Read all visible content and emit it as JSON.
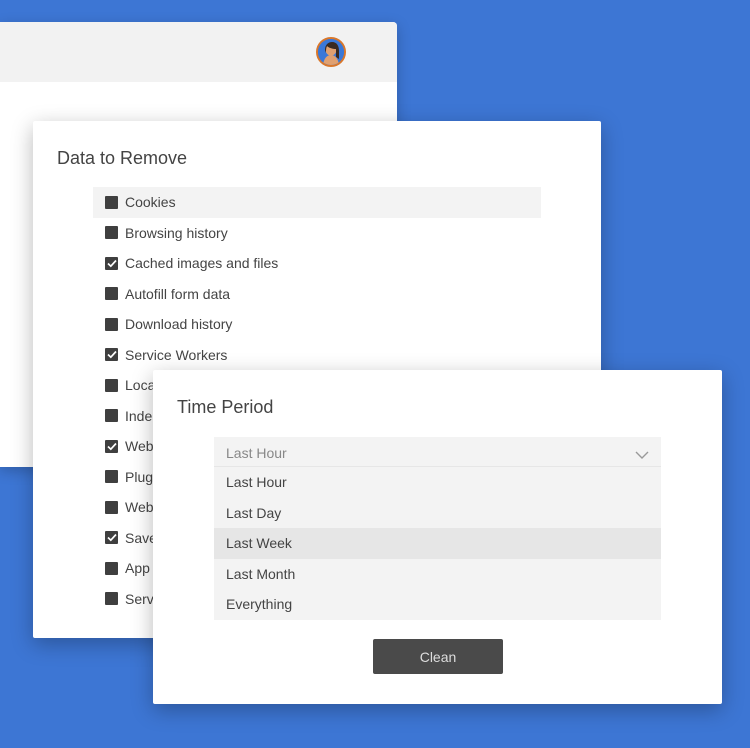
{
  "colors": {
    "background": "#3d76d4",
    "button": "#4a4a4a",
    "checkbox": "#3f3f3f",
    "highlight": "#f3f3f3"
  },
  "back_window": {
    "avatar_icon": "user-avatar-icon"
  },
  "data_dialog": {
    "title": "Data to Remove",
    "items": [
      {
        "label": "Cookies",
        "checked": false
      },
      {
        "label": "Browsing history",
        "checked": false
      },
      {
        "label": "Cached images and files",
        "checked": true
      },
      {
        "label": "Autofill form data",
        "checked": false
      },
      {
        "label": "Download history",
        "checked": false
      },
      {
        "label": "Service Workers",
        "checked": true
      },
      {
        "label": "Loca",
        "checked": false
      },
      {
        "label": "Inde",
        "checked": false
      },
      {
        "label": "Web",
        "checked": true
      },
      {
        "label": "Plug",
        "checked": false
      },
      {
        "label": "Web",
        "checked": false
      },
      {
        "label": "Save",
        "checked": true
      },
      {
        "label": "App",
        "checked": false
      },
      {
        "label": "Serv",
        "checked": false
      }
    ]
  },
  "time_dialog": {
    "title": "Time Period",
    "selected": "Last Hour",
    "options": [
      "Last Hour",
      "Last Day",
      "Last Week",
      "Last Month",
      "Everything"
    ],
    "highlighted_option": "Last Week",
    "clean_label": "Clean"
  }
}
